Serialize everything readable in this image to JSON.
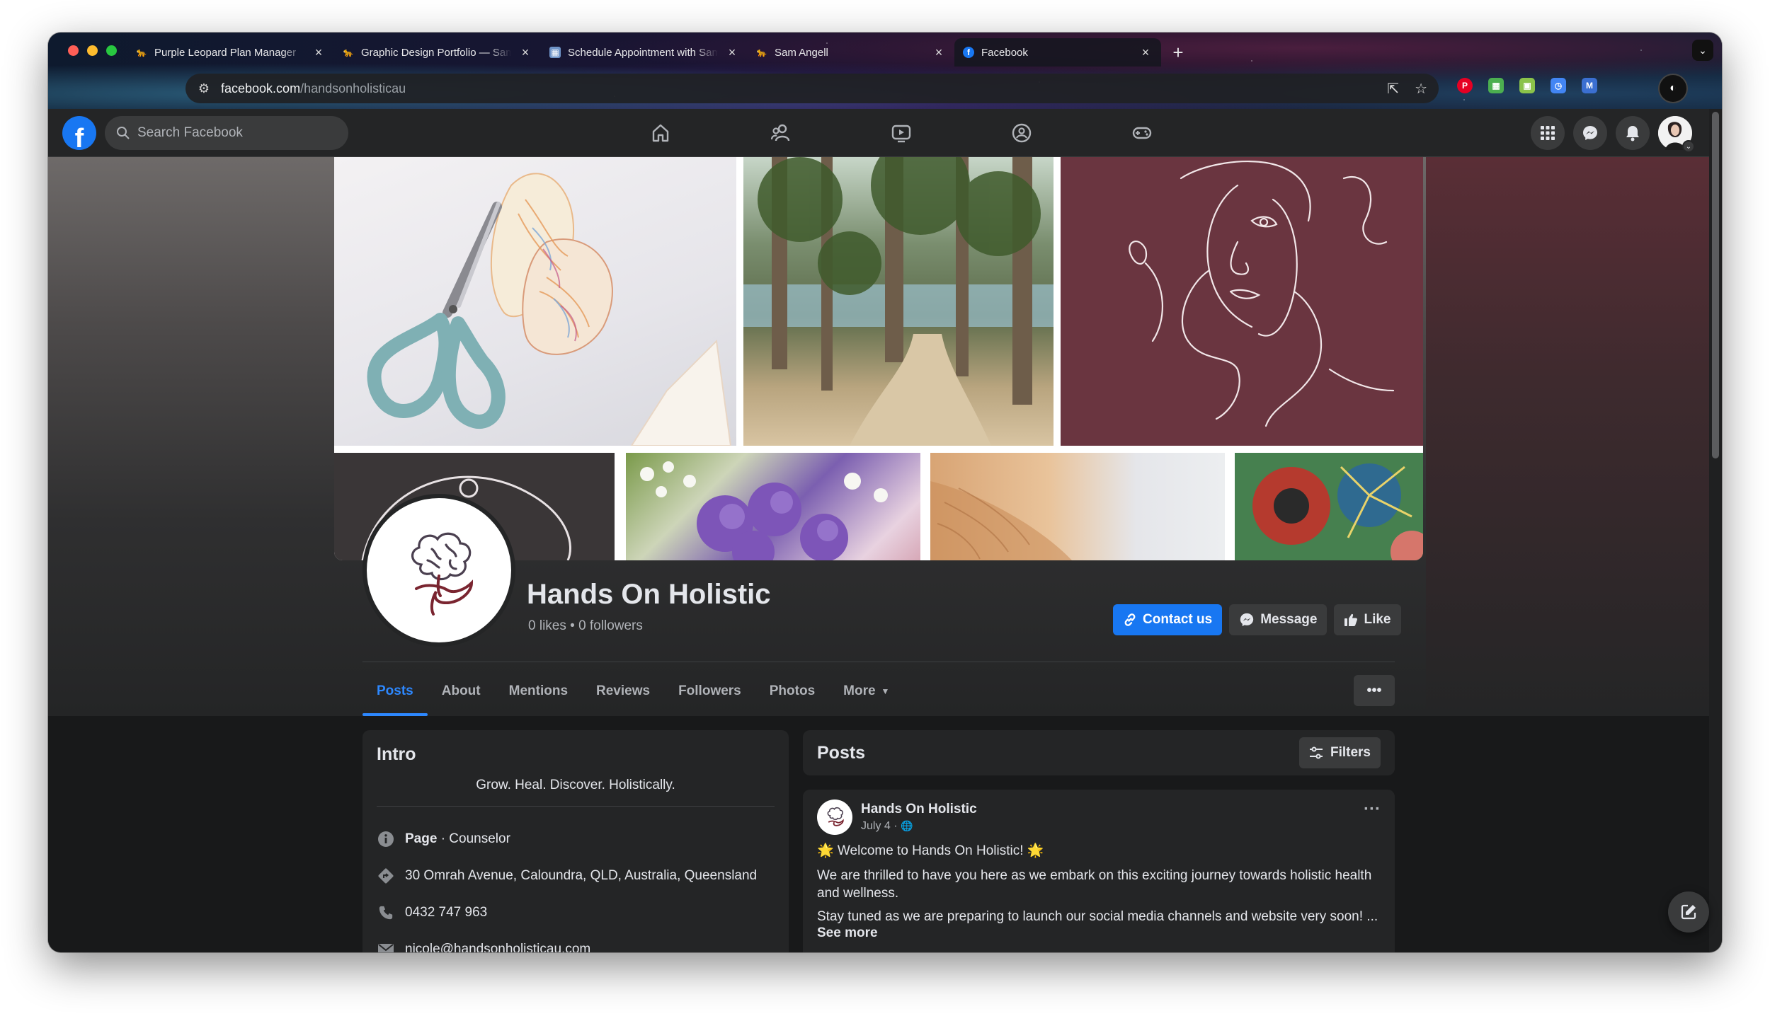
{
  "browser": {
    "tabs": [
      {
        "title": "Purple Leopard Plan Manager",
        "favicon": "leopard-icon",
        "active": false
      },
      {
        "title": "Graphic Design Portfolio — Sam",
        "favicon": "leopard-icon",
        "active": false
      },
      {
        "title": "Schedule Appointment with Sam",
        "favicon": "calendar-icon",
        "active": false
      },
      {
        "title": "Sam Angell",
        "favicon": "leopard-icon",
        "active": false
      },
      {
        "title": "Facebook",
        "favicon": "facebook-icon",
        "active": true
      }
    ],
    "new_tab": "+",
    "url_domain": "facebook.com",
    "url_path": "/handsonholisticau",
    "extensions": [
      {
        "name": "pinterest-icon",
        "color": "#e60023",
        "glyph": "P"
      },
      {
        "name": "sheets-icon",
        "color": "#4caf50",
        "glyph": "▦"
      },
      {
        "name": "save-icon",
        "color": "#8bc34a",
        "glyph": "▣"
      },
      {
        "name": "clock-icon",
        "color": "#4285f4",
        "glyph": "◷"
      },
      {
        "name": "gmail-icon",
        "color": "#3b6fd1",
        "glyph": "M"
      }
    ]
  },
  "facebook": {
    "search_placeholder": "Search Facebook",
    "page": {
      "name": "Hands On Holistic",
      "stats": "0 likes • 0 followers",
      "actions": {
        "contact": "Contact us",
        "message": "Message",
        "like": "Like"
      },
      "tabs": [
        "Posts",
        "About",
        "Mentions",
        "Reviews",
        "Followers",
        "Photos",
        "More"
      ],
      "active_tab": "Posts",
      "more_options": "•••"
    },
    "intro": {
      "title": "Intro",
      "bio": "Grow. Heal. Discover. Holistically.",
      "page_label": "Page",
      "category": " · Counselor",
      "address": "30 Omrah Avenue, Caloundra, QLD, Australia, Queensland",
      "phone": "0432 747 963",
      "email": "nicole@handsonholisticau.com"
    },
    "posts": {
      "title": "Posts",
      "filters": "Filters",
      "post": {
        "author": "Hands On Holistic",
        "date": "July 4 · ",
        "line1": "🌟 Welcome to Hands On Holistic! 🌟",
        "line2": "We are thrilled to have you here as we embark on this exciting journey towards holistic health and wellness.",
        "line3": "Stay tuned as we are preparing to launch our social media channels and website very soon! ...",
        "see_more": "See more"
      }
    }
  },
  "colors": {
    "accent": "#1877f2",
    "active_tab": "#2d88ff",
    "surface": "#242526",
    "background": "#18191a"
  }
}
